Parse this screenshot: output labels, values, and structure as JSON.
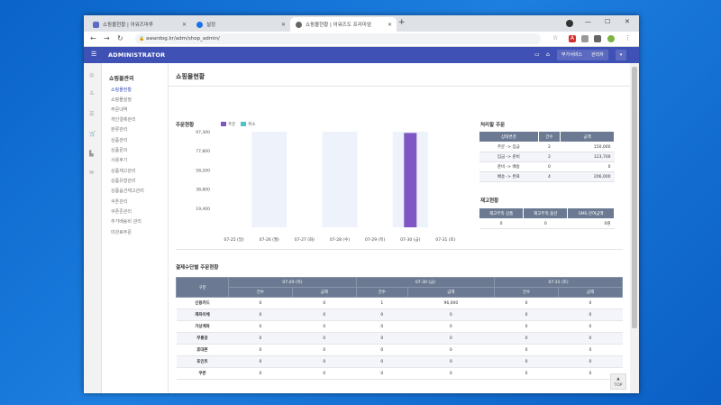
{
  "browser": {
    "tabs": [
      {
        "label": "쇼핑몰현황 | 어워즈마루"
      },
      {
        "label": "설정"
      },
      {
        "label": "쇼핑몰현황 | 어워즈도 프리미엄"
      }
    ],
    "url": "awardog.kr/adm/shop_admin/"
  },
  "header": {
    "brand": "ADMINISTRATOR",
    "buttons": [
      "부가서비스",
      "관리자"
    ]
  },
  "sidebar": {
    "title": "쇼핑몰관리",
    "items": [
      "쇼핑몰현황",
      "쇼핑몰설정",
      "주문내역",
      "개인결제관리",
      "분류관리",
      "상품관리",
      "상품문의",
      "사용후기",
      "상품재고관리",
      "상품유형관리",
      "상품옵션재고관리",
      "쿠폰관리",
      "쿠폰존관리",
      "추가배송비 관리",
      "미완료주문"
    ]
  },
  "page": {
    "title": "쇼핑몰현황",
    "order_title": "주문현황",
    "legend": [
      "주문",
      "취소"
    ],
    "status_title": "처리할 주문",
    "stock_title": "재고현황",
    "payment_title": "결제수단별 주문현황",
    "top_label": "TOP"
  },
  "colors": {
    "order": "#7e57c2",
    "cancel": "#4fc3c7",
    "header": "#3f51b5"
  },
  "chart_data": {
    "type": "bar",
    "categories": [
      "07-25 (일)",
      "07-26 (월)",
      "07-27 (화)",
      "07-28 (수)",
      "07-29 (목)",
      "07-30 (금)",
      "07-31 (토)"
    ],
    "yticks": [
      "97,300",
      "77,800",
      "58,200",
      "38,800",
      "19,400"
    ],
    "ylim": [
      0,
      97300
    ],
    "series": [
      {
        "name": "주문",
        "values": [
          0,
          0,
          0,
          0,
          0,
          96000,
          0
        ]
      },
      {
        "name": "취소",
        "values": [
          0,
          0,
          0,
          0,
          0,
          0,
          0
        ]
      }
    ]
  },
  "order_status": {
    "headers": [
      "상태변경",
      "건수",
      "금액"
    ],
    "rows": [
      [
        "주문 -> 입금",
        "2",
        "150,000"
      ],
      [
        "입금 -> 준비",
        "2",
        "123,700"
      ],
      [
        "준비 -> 배송",
        "0",
        "0"
      ],
      [
        "배송 -> 완료",
        "4",
        "206,000"
      ]
    ]
  },
  "stock": {
    "headers": [
      "재고부족 상품",
      "재고부족 옵션",
      "SMS 잔여금액"
    ],
    "row": [
      "0",
      "0",
      "0원"
    ]
  },
  "payment": {
    "method_header": "구분",
    "dates": [
      "07-29 (목)",
      "07-30 (금)",
      "07-31 (토)"
    ],
    "sub_headers": [
      "건수",
      "금액"
    ],
    "rows": [
      {
        "method": "신용카드",
        "values": [
          "0",
          "0",
          "1",
          "96,000",
          "0",
          "0"
        ]
      },
      {
        "method": "계좌이체",
        "values": [
          "0",
          "0",
          "0",
          "0",
          "0",
          "0"
        ]
      },
      {
        "method": "가상계좌",
        "values": [
          "0",
          "0",
          "0",
          "0",
          "0",
          "0"
        ]
      },
      {
        "method": "무통장",
        "values": [
          "0",
          "0",
          "0",
          "0",
          "0",
          "0"
        ]
      },
      {
        "method": "휴대폰",
        "values": [
          "0",
          "0",
          "0",
          "0",
          "0",
          "0"
        ]
      },
      {
        "method": "포인트",
        "values": [
          "0",
          "0",
          "0",
          "0",
          "0",
          "0"
        ]
      },
      {
        "method": "쿠폰",
        "values": [
          "0",
          "0",
          "0",
          "0",
          "0",
          "0"
        ]
      }
    ]
  }
}
